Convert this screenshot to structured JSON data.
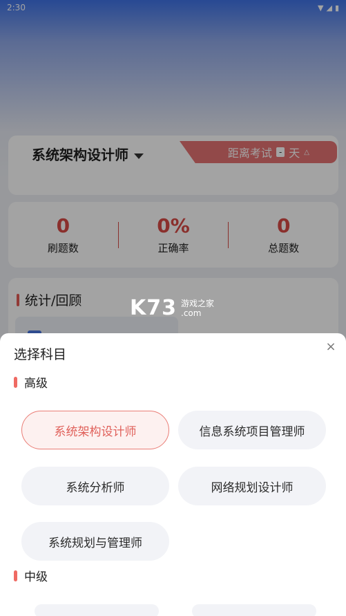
{
  "status_bar": {
    "time": "2:30"
  },
  "subject_card": {
    "title": "系统架构设计师",
    "exam_countdown": {
      "prefix": "距离考试",
      "days": "-",
      "suffix": "天"
    }
  },
  "stats": [
    {
      "value": "0",
      "label": "刷题数"
    },
    {
      "value": "0%",
      "label": "正确率"
    },
    {
      "value": "0",
      "label": "总题数"
    }
  ],
  "review_section": {
    "title": "统计/回顾"
  },
  "watermark": {
    "logo": "K73",
    "line1": "游戏之家",
    "line2": ".com"
  },
  "sheet": {
    "title": "选择科目",
    "close_symbol": "×",
    "levels": [
      {
        "name": "高级",
        "options": [
          "系统架构设计师",
          "信息系统项目管理师",
          "系统分析师",
          "网络规划设计师",
          "系统规划与管理师"
        ],
        "selected": "系统架构设计师"
      },
      {
        "name": "中级",
        "options": []
      }
    ]
  },
  "colors": {
    "accent_red": "#e0605a",
    "chip_bg": "#f2f3f7"
  }
}
